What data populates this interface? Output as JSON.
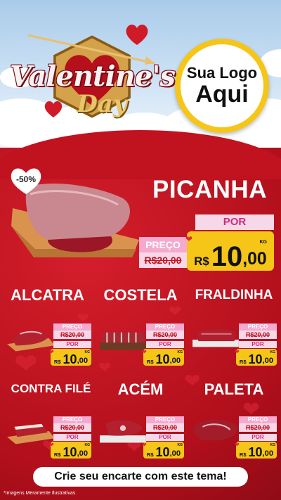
{
  "header": {
    "logo_title": "Valentine's",
    "logo_sub": "Day",
    "brand_line1": "Sua Logo",
    "brand_line2": "Aqui"
  },
  "featured": {
    "name": "PICANHA",
    "discount": "-50%",
    "preco_label": "PREÇO",
    "old_price": "R$20,00",
    "por_label": "POR",
    "currency": "R$",
    "price_int": "10",
    "price_dec": ",00",
    "unit": "KG"
  },
  "products": [
    {
      "name": "ALCATRA",
      "preco_label": "PREÇO",
      "old_price": "R$20,00",
      "por_label": "POR",
      "currency": "R$",
      "price_int": "10",
      "price_dec": ",00",
      "unit": "KG"
    },
    {
      "name": "COSTELA",
      "preco_label": "PREÇO",
      "old_price": "R$20,00",
      "por_label": "POR",
      "currency": "R$",
      "price_int": "10",
      "price_dec": ",00",
      "unit": "KG"
    },
    {
      "name": "FRALDINHA",
      "preco_label": "PREÇO",
      "old_price": "R$20,00",
      "por_label": "POR",
      "currency": "R$",
      "price_int": "10",
      "price_dec": ",00",
      "unit": "KG"
    },
    {
      "name": "CONTRA FILÉ",
      "preco_label": "PREÇO",
      "old_price": "R$20,00",
      "por_label": "POR",
      "currency": "R$",
      "price_int": "10",
      "price_dec": ",00",
      "unit": "KG"
    },
    {
      "name": "ACÉM",
      "preco_label": "PREÇO",
      "old_price": "R$20,00",
      "por_label": "POR",
      "currency": "R$",
      "price_int": "10",
      "price_dec": ",00",
      "unit": "KG"
    },
    {
      "name": "PALETA",
      "preco_label": "PREÇO",
      "old_price": "R$20,00",
      "por_label": "POR",
      "currency": "R$",
      "price_int": "10",
      "price_dec": ",00",
      "unit": "KG"
    }
  ],
  "cta": "Crie seu encarte com este tema!",
  "footnote": "*Imagens Meramente Ilustrativas",
  "colors": {
    "background_red": "#c1121f",
    "accent_yellow": "#f5c518",
    "pink": "#f4a9cf"
  }
}
